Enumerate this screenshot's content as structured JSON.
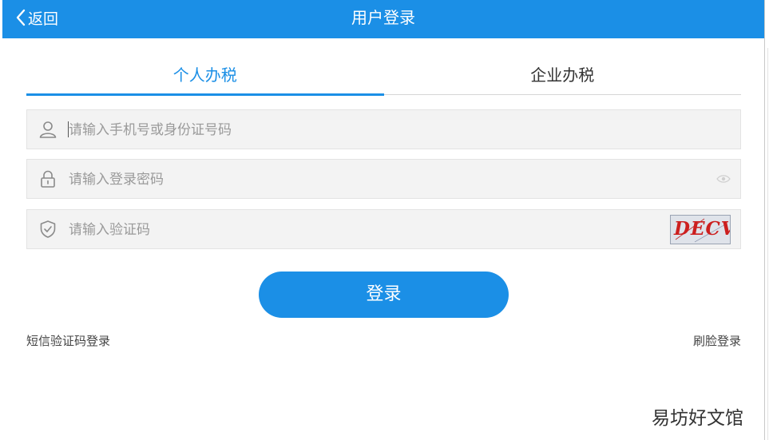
{
  "header": {
    "back_label": "返回",
    "title": "用户登录"
  },
  "tabs": [
    {
      "label": "个人办税",
      "active": true
    },
    {
      "label": "企业办税",
      "active": false
    }
  ],
  "form": {
    "account_placeholder": "请输入手机号或身份证号码",
    "password_placeholder": "请输入登录密码",
    "captcha_placeholder": "请输入验证码",
    "captcha_text": "DECV"
  },
  "login_label": "登录",
  "links": {
    "sms_login": "短信验证码登录",
    "face_login": "刷脸登录"
  },
  "watermark": "易坊好文馆",
  "colors": {
    "accent": "#1b8fe6",
    "field_bg": "#f3f3f3",
    "captcha_text": "#cc1f1f"
  },
  "icons": [
    "chevron-left-icon",
    "user-icon",
    "lock-icon",
    "shield-check-icon",
    "eye-icon"
  ]
}
